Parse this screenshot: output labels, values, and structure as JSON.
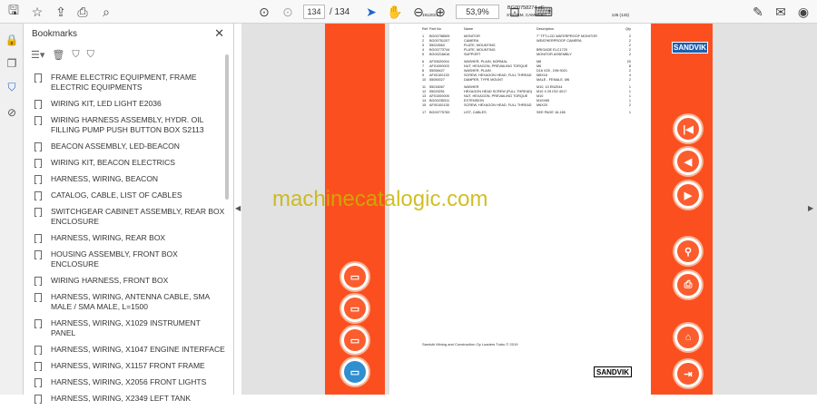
{
  "toolbar": {
    "page_current": "134",
    "page_total": "/ 134",
    "zoom": "53,9%"
  },
  "panel": {
    "title": "Bookmarks",
    "close": "✕",
    "items": [
      "FRAME ELECTRIC EQUIPMENT, FRAME ELECTRIC EQUIPMENTS",
      "WIRING KIT, LED LIGHT E2036",
      "WIRING HARNESS ASSEMBLY, HYDR. OIL FILLING PUMP PUSH BUTTON BOX S2113",
      "BEACON ASSEMBLY, LED-BEACON",
      "WIRING KIT, BEACON ELECTRICS",
      "HARNESS, WIRING, BEACON",
      "CATALOG, CABLE, LIST OF CABLES",
      "SWITCHGEAR CABINET ASSEMBLY, REAR BOX ENCLOSURE",
      "HARNESS, WIRING, REAR BOX",
      "HOUSING ASSEMBLY, FRONT BOX ENCLOSURE",
      "WIRING HARNESS, FRONT BOX",
      "HARNESS, WIRING, ANTENNA CABLE, SMA MALE / SMA MALE, L=1500",
      "HARNESS, WIRING, X1029 INSTRUMENT PANEL",
      "HARNESS, WIRING, X1047 ENGINE INTERFACE",
      "HARNESS, WIRING, X1157 FRONT FRAME",
      "HARNESS, WIRING, X2056 FRONT LIGHTS",
      "HARNESS, WIRING, X2349 LEFT TANK"
    ]
  },
  "document": {
    "doc_id": "BG00758274 eE",
    "date": "1912021",
    "section": "SYSTEM, CAMERA",
    "page_ref": "135 (133)",
    "columns": [
      "Ref",
      "Part No",
      "Name",
      "Description",
      "Qty"
    ],
    "rows": [
      [
        "1",
        "BG00758505",
        "MONITOR",
        "7\" TFT-LCD WATERPROOF MONITOR",
        "2"
      ],
      [
        "2",
        "BG00751207",
        "CAMERA",
        "WEATHERPROOF CAMERA",
        "2"
      ],
      [
        "3",
        "55024563",
        "PLATE, MOUNTING",
        "",
        "2"
      ],
      [
        "4",
        "BG00773744",
        "PLATE, MOUNTING",
        "BRIGADE ELC1720",
        "2"
      ],
      [
        "5",
        "BG00216616",
        "SUPPORT",
        "MONITOR ASSEMBLY",
        "2"
      ],
      [
        "6",
        "AF03020004",
        "WASHER, PLAIN, NORMAL",
        "M6",
        "20"
      ],
      [
        "7",
        "AF01000003",
        "NUT, HEXAGON, PREVAILING TORQUE",
        "M6",
        "8"
      ],
      [
        "8",
        "55056427",
        "WASHER, PLAIN",
        "D16 X25 , DIN 9021",
        "2"
      ],
      [
        "9",
        "AF00100133",
        "SCREW, HEXAGON HEAD, FULL THREAD",
        "M6X16",
        "4"
      ],
      [
        "10",
        "55050027",
        "DAMPER, TYPE MOUNT",
        "MALE - FEMALE, M6",
        "2"
      ],
      [
        "11",
        "55016067",
        "WASHER",
        "M10, 10 EN2044",
        "1"
      ],
      [
        "12",
        "55029251",
        "HEXAGON HEAD SCREW (FULL THREAD)",
        "M10 X 25 ISO 4017",
        "1"
      ],
      [
        "13",
        "AF01000005",
        "NUT, HEXAGON, PREVAILING TORQUE",
        "M10",
        "1"
      ],
      [
        "14",
        "BG00235311",
        "EXTENSION",
        "M10X65",
        "1"
      ],
      [
        "15",
        "AF00100135",
        "SCREW, HEXAGON HEAD, FULL THREAD",
        "M6X20",
        "2"
      ],
      [
        "17",
        "BG00775783",
        "LIST, CABLES",
        "SEE PAGE 16-165",
        "1"
      ]
    ],
    "footer": "Sandvik Mining and Construction Oy Loaders Turku © 2019",
    "logo": "SANDVIK"
  },
  "watermark": "machinecatalogic.com",
  "colors": {
    "band": "#fc4f1f",
    "viewer_bg": "#e2e2e2",
    "nav_circle": "#fc5d2e",
    "active_circle": "#2f8fd0",
    "logo": "#1f5fae"
  }
}
